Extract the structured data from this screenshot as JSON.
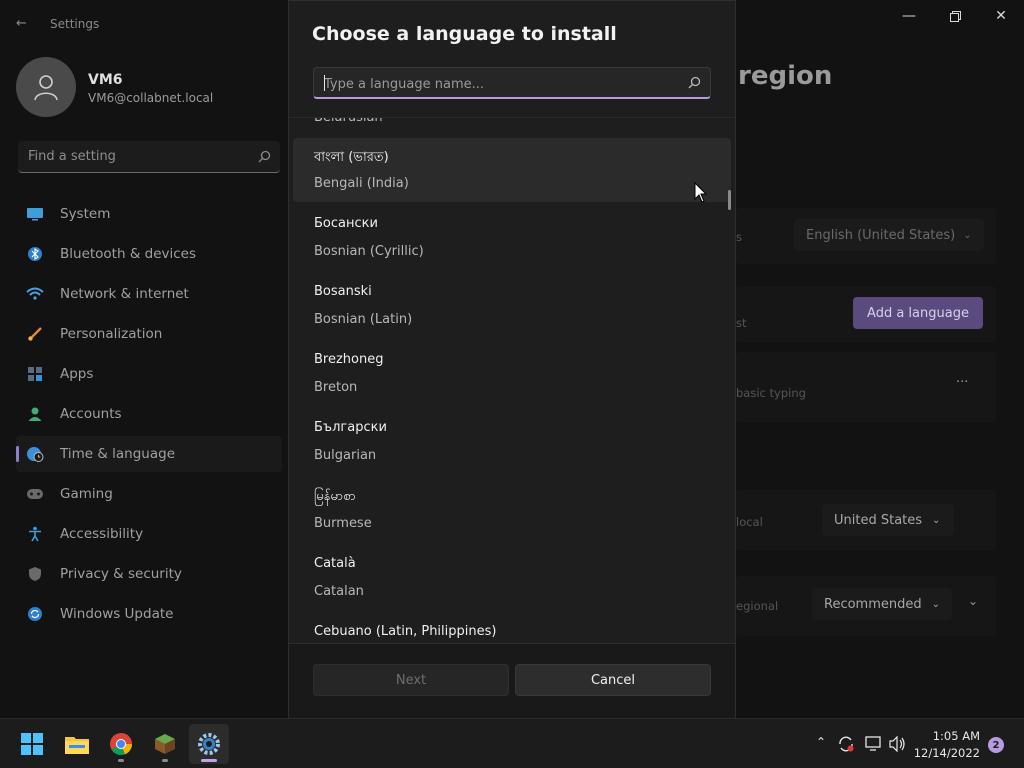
{
  "settings": {
    "window_title": "Settings",
    "user": {
      "name": "VM6",
      "email": "VM6@collabnet.local"
    },
    "search_placeholder": "Find a setting",
    "nav": [
      {
        "label": "System",
        "icon": "monitor-icon"
      },
      {
        "label": "Bluetooth & devices",
        "icon": "bluetooth-icon"
      },
      {
        "label": "Network & internet",
        "icon": "wifi-icon"
      },
      {
        "label": "Personalization",
        "icon": "brush-icon"
      },
      {
        "label": "Apps",
        "icon": "apps-icon"
      },
      {
        "label": "Accounts",
        "icon": "person-icon"
      },
      {
        "label": "Time & language",
        "icon": "globe-clock-icon",
        "active": true
      },
      {
        "label": "Gaming",
        "icon": "gamepad-icon"
      },
      {
        "label": "Accessibility",
        "icon": "accessibility-icon"
      },
      {
        "label": "Privacy & security",
        "icon": "shield-icon"
      },
      {
        "label": "Windows Update",
        "icon": "update-icon"
      }
    ],
    "page_title_fragment": "region",
    "display_language_value": "English (United States)",
    "preferred_languages_fragment": "st",
    "add_language_label": "Add a language",
    "basic_typing_fragment": "basic typing",
    "more_options_label": "···",
    "country_fragment": "local",
    "country_value": "United States",
    "regional_format_fragment": "egional",
    "regional_format_value": "Recommended",
    "colors": {
      "accent": "#b89ae0",
      "nav_accent": "#8e7fc8",
      "add_button": "#5b4a7e"
    }
  },
  "dialog": {
    "title": "Choose a language to install",
    "search_placeholder": "Type a language name...",
    "partial_top_item": "Belarusian",
    "languages": [
      {
        "native": "বাংলা (ভারত)",
        "english": "Bengali (India)",
        "hover": true
      },
      {
        "native": "Босански",
        "english": "Bosnian (Cyrillic)"
      },
      {
        "native": "Bosanski",
        "english": "Bosnian (Latin)"
      },
      {
        "native": "Brezhoneg",
        "english": "Breton"
      },
      {
        "native": "Български",
        "english": "Bulgarian"
      },
      {
        "native": "မြန်မာစာ",
        "english": "Burmese"
      },
      {
        "native": "Català",
        "english": "Catalan"
      },
      {
        "native": "Cebuano (Latin, Philippines)",
        "english": ""
      }
    ],
    "next_label": "Next",
    "cancel_label": "Cancel"
  },
  "taskbar": {
    "apps": [
      {
        "name": "start-icon"
      },
      {
        "name": "file-explorer-icon",
        "running": false
      },
      {
        "name": "chrome-icon",
        "running": true
      },
      {
        "name": "minecraft-icon",
        "running": true
      },
      {
        "name": "settings-icon",
        "running": true,
        "active": true
      }
    ],
    "time": "1:05 AM",
    "date": "12/14/2022",
    "notification_count": "2"
  }
}
